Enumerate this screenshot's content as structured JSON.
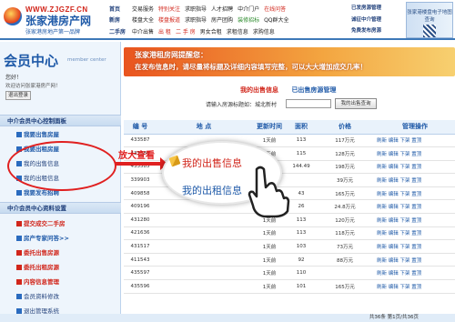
{
  "header": {
    "site_url": "WWW.ZJGZF.CN",
    "brand_name": "张家港房产网",
    "slogan": "张家港房地产第一品牌",
    "nav_rows": [
      [
        "首页",
        "交易服务",
        "特别关注",
        "求职指导",
        "人才招聘",
        "中介门户",
        "在线问答"
      ],
      [
        "新房",
        "楼盘大全",
        "楼盘报道",
        "求职指导",
        "房产团购",
        "装修招标",
        "QQ群大全"
      ],
      [
        "二手房",
        "中介出售",
        "出 租",
        "二 手 房",
        "男女合租",
        "求租信息",
        "求购信息"
      ]
    ],
    "promo": [
      "已发房源管理",
      "诚征中介管理",
      "免费发布房源"
    ],
    "qr_label": "张家港楼盘电子地图查询"
  },
  "sidebar": {
    "title": "会员中心",
    "title_sub": "member center",
    "user_prefix": "您好！",
    "username": "",
    "welcome": "欢迎访问张家港房产网！",
    "logout": "退出登录",
    "sections": [
      {
        "title": "中介会员中心控制面板",
        "items": [
          "我要出售房屋",
          "我要出租房屋",
          "我的出售信息",
          "我的出租信息",
          "我要发布招聘"
        ]
      },
      {
        "title": "中介会员中心资料设置",
        "items": [
          "提交成交二手房",
          "房产专家问答>>",
          "委托出售房源",
          "委托出租房源",
          "内容信息管理",
          "会员资料修改",
          "退出管理系统"
        ]
      }
    ]
  },
  "main": {
    "banner_line1": "张家港租房网提醒您：",
    "banner_line2": "在发布信息时，请尽量将标题及详细内容填写完整，可以大大增加成交几率！",
    "tabs": [
      "我的出售信息",
      "已出售房源管理"
    ],
    "search_label": "请输入房源标题如：城北新村",
    "search_button": "我的出售查询",
    "table": {
      "headers": [
        "编 号",
        "地  点",
        "更新时间",
        "面积",
        "价格",
        "管理操作"
      ],
      "rows": [
        [
          "433587",
          "",
          "1天前",
          "113",
          "117万元",
          "刷新 编辑 下架 置顶"
        ],
        [
          "433586",
          "",
          "1天前",
          "115",
          "128万元",
          "刷新 编辑 下架 置顶"
        ],
        [
          "433585",
          "",
          "1天前",
          "144.49",
          "198万元",
          "刷新 编辑 下架 置顶"
        ],
        [
          "339903",
          "",
          "1天前",
          "",
          "39万元",
          "刷新 编辑 下架 置顶"
        ],
        [
          "409858",
          "",
          "1天前",
          "43",
          "165万元",
          "刷新 编辑 下架 置顶"
        ],
        [
          "409196",
          "",
          "1天前",
          "26",
          "24.8万元",
          "刷新 编辑 下架 置顶"
        ],
        [
          "431280",
          "",
          "1天前",
          "113",
          "120万元",
          "刷新 编辑 下架 置顶"
        ],
        [
          "421636",
          "",
          "1天前",
          "113",
          "118万元",
          "刷新 编辑 下架 置顶"
        ],
        [
          "431517",
          "",
          "1天前",
          "103",
          "73万元",
          "刷新 编辑 下架 置顶"
        ],
        [
          "411543",
          "",
          "1天前",
          "92",
          "88万元",
          "刷新 编辑 下架 置顶"
        ],
        [
          "435597",
          "",
          "1天前",
          "110",
          "",
          "刷新 编辑 下架 置顶"
        ],
        [
          "435596",
          "",
          "1天前",
          "101",
          "165万元",
          "刷新 编辑 下架 置顶"
        ]
      ]
    },
    "footer": "共36条 第1页/共36页"
  },
  "annotation": {
    "callout": "放大查看",
    "zoom_line1": "我的出售信息",
    "zoom_line2": "我的出租信息"
  },
  "colors": {
    "brand_blue": "#1f5aa8",
    "brand_red": "#d1261b",
    "banner_orange": "#e9541f",
    "annotation_red": "#e02020"
  }
}
